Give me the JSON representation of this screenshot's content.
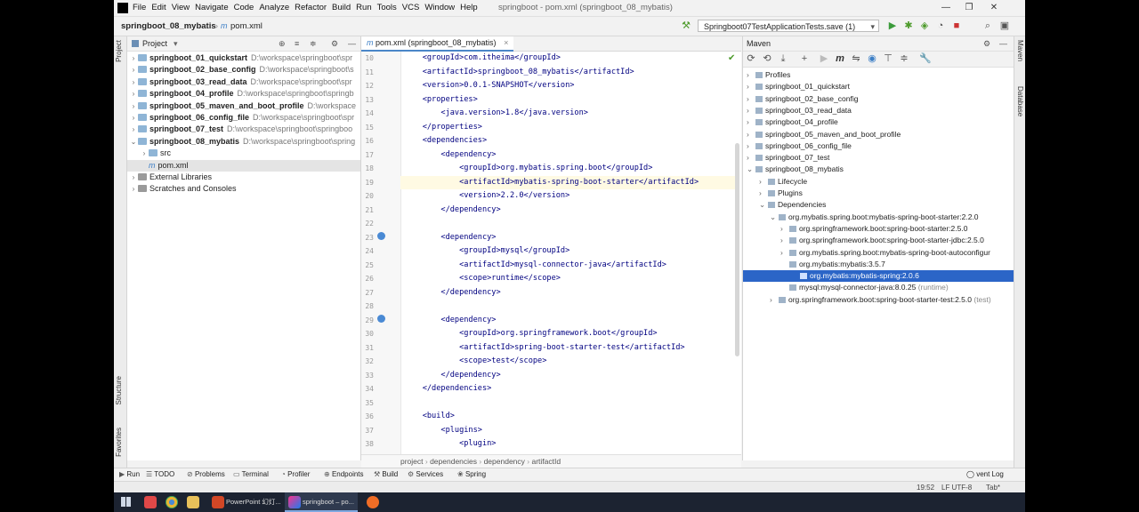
{
  "menu": [
    "File",
    "Edit",
    "View",
    "Navigate",
    "Code",
    "Analyze",
    "Refactor",
    "Build",
    "Run",
    "Tools",
    "VCS",
    "Window",
    "Help"
  ],
  "window_title": "springboot - pom.xml (springboot_08_mybatis)",
  "breadcrumb_top": {
    "project": "springboot_08_mybatis",
    "file": "pom.xml"
  },
  "run_config": "Springboot07TestApplicationTests.save (1)",
  "project_panel": {
    "title": "Project",
    "items": [
      {
        "name": "springboot_01_quickstart",
        "path": "D:\\workspace\\springboot\\spr"
      },
      {
        "name": "springboot_02_base_config",
        "path": "D:\\workspace\\springboot\\s"
      },
      {
        "name": "springboot_03_read_data",
        "path": "D:\\workspace\\springboot\\spr"
      },
      {
        "name": "springboot_04_profile",
        "path": "D:\\workspace\\springboot\\springb"
      },
      {
        "name": "springboot_05_maven_and_boot_profile",
        "path": "D:\\workspace"
      },
      {
        "name": "springboot_06_config_file",
        "path": "D:\\workspace\\springboot\\spr"
      },
      {
        "name": "springboot_07_test",
        "path": "D:\\workspace\\springboot\\springboo"
      },
      {
        "name": "springboot_08_mybatis",
        "path": "D:\\workspace\\springboot\\spring"
      }
    ],
    "sub_src": "src",
    "sub_pom": "pom.xml",
    "external_libraries": "External Libraries",
    "scratches": "Scratches and Consoles"
  },
  "editor": {
    "tab_label": "pom.xml (springboot_08_mybatis)",
    "lines": [
      {
        "num": "10",
        "text": "    <groupId>com.itheima</groupId>"
      },
      {
        "num": "11",
        "text": "    <artifactId>springboot_08_mybatis</artifactId>"
      },
      {
        "num": "12",
        "text": "    <version>0.0.1-SNAPSHOT</version>"
      },
      {
        "num": "13",
        "text": "    <properties>"
      },
      {
        "num": "14",
        "text": "        <java.version>1.8</java.version>"
      },
      {
        "num": "15",
        "text": "    </properties>"
      },
      {
        "num": "16",
        "text": "    <dependencies>"
      },
      {
        "num": "17",
        "text": "        <dependency>"
      },
      {
        "num": "18",
        "text": "            <groupId>org.mybatis.spring.boot</groupId>"
      },
      {
        "num": "19",
        "text": "            <artifactId>mybatis-spring-boot-starter</artifactId>"
      },
      {
        "num": "20",
        "text": "            <version>2.2.0</version>"
      },
      {
        "num": "21",
        "text": "        </dependency>"
      },
      {
        "num": "22",
        "text": ""
      },
      {
        "num": "23",
        "text": "        <dependency>"
      },
      {
        "num": "24",
        "text": "            <groupId>mysql</groupId>"
      },
      {
        "num": "25",
        "text": "            <artifactId>mysql-connector-java</artifactId>"
      },
      {
        "num": "26",
        "text": "            <scope>runtime</scope>"
      },
      {
        "num": "27",
        "text": "        </dependency>"
      },
      {
        "num": "28",
        "text": ""
      },
      {
        "num": "29",
        "text": "        <dependency>"
      },
      {
        "num": "30",
        "text": "            <groupId>org.springframework.boot</groupId>"
      },
      {
        "num": "31",
        "text": "            <artifactId>spring-boot-starter-test</artifactId>"
      },
      {
        "num": "32",
        "text": "            <scope>test</scope>"
      },
      {
        "num": "33",
        "text": "        </dependency>"
      },
      {
        "num": "34",
        "text": "    </dependencies>"
      },
      {
        "num": "35",
        "text": ""
      },
      {
        "num": "36",
        "text": "    <build>"
      },
      {
        "num": "37",
        "text": "        <plugins>"
      },
      {
        "num": "38",
        "text": "            <plugin>"
      }
    ],
    "breadcrumbs": [
      "project",
      "dependencies",
      "dependency",
      "artifactId"
    ]
  },
  "maven": {
    "title": "Maven",
    "rows": [
      {
        "label": "Profiles",
        "selected": false
      },
      {
        "label": "springboot_01_quickstart",
        "selected": false
      },
      {
        "label": "springboot_02_base_config",
        "selected": false
      },
      {
        "label": "springboot_03_read_data",
        "selected": false
      },
      {
        "label": "springboot_04_profile",
        "selected": false
      },
      {
        "label": "springboot_05_maven_and_boot_profile",
        "selected": false
      },
      {
        "label": "springboot_06_config_file",
        "selected": false
      },
      {
        "label": "springboot_07_test",
        "selected": false
      },
      {
        "label": "springboot_08_mybatis",
        "selected": false
      },
      {
        "label": "Lifecycle",
        "selected": false
      },
      {
        "label": "Plugins",
        "selected": false
      },
      {
        "label": "Dependencies",
        "selected": false
      },
      {
        "label": "org.mybatis.spring.boot:mybatis-spring-boot-starter:2.2.0",
        "selected": false
      },
      {
        "label": "org.springframework.boot:spring-boot-starter:2.5.0",
        "selected": false
      },
      {
        "label": "org.springframework.boot:spring-boot-starter-jdbc:2.5.0",
        "selected": false
      },
      {
        "label": "org.mybatis.spring.boot:mybatis-spring-boot-autoconfigur",
        "selected": false
      },
      {
        "label": "org.mybatis:mybatis:3.5.7",
        "selected": false
      },
      {
        "label": "org.mybatis:mybatis-spring:2.0.6",
        "selected": true
      },
      {
        "label": "mysql:mysql-connector-java:8.0.25",
        "suffix": "(runtime)",
        "selected": false
      },
      {
        "label": "org.springframework.boot:spring-boot-starter-test:2.5.0",
        "suffix": "(test)",
        "selected": false
      }
    ]
  },
  "left_strip": {
    "project": "Project",
    "structure": "Structure",
    "favorites": "Favorites"
  },
  "right_strip": {
    "maven": "Maven",
    "database": "Database"
  },
  "bottom_tools": [
    "Run",
    "TODO",
    "Problems",
    "Terminal",
    "Profiler",
    "Endpoints",
    "Build",
    "Services",
    "Spring"
  ],
  "event_log": "vent Log",
  "status": {
    "position": "19:52",
    "encoding": "LF  UTF-8",
    "indent": "Tab*"
  },
  "taskbar": {
    "powerpoint": "PowerPoint 幻灯...",
    "idea": "springboot – po..."
  },
  "colors": {
    "selection": "#2b65c7",
    "tag": "#000080",
    "taskbar": "#1c2331"
  }
}
